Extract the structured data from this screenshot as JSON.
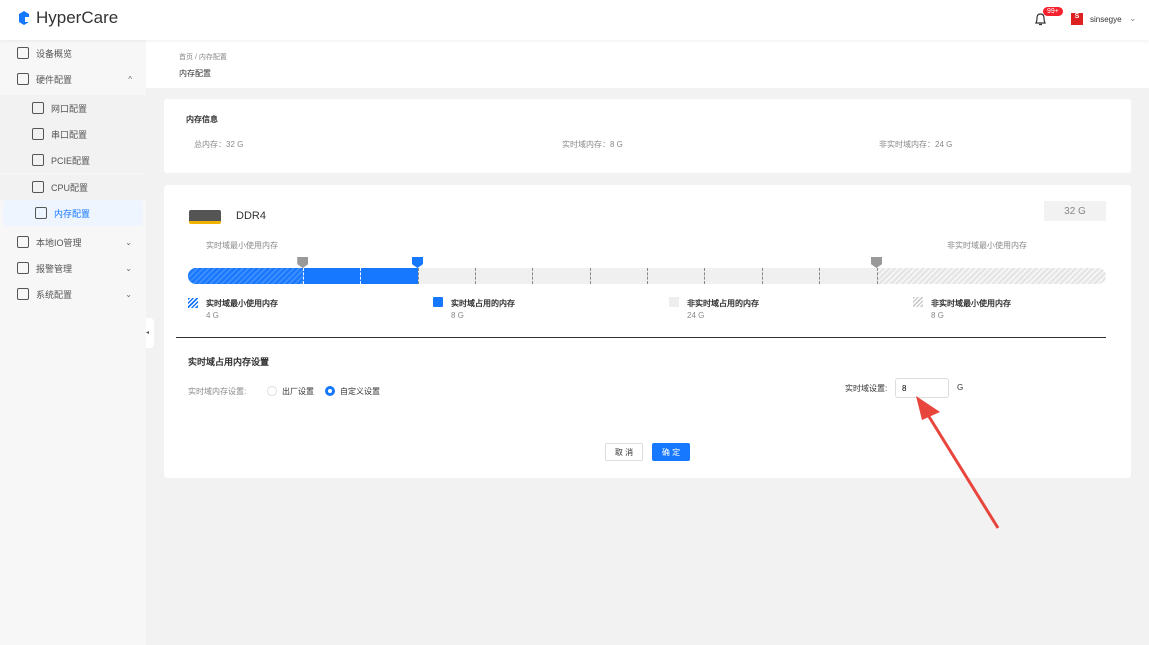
{
  "app": {
    "name": "HyperCare"
  },
  "header": {
    "badge": "99+",
    "username": "sinsegye"
  },
  "sidebar": {
    "items": [
      {
        "label": "设备概览"
      },
      {
        "label": "硬件配置"
      },
      {
        "label": "网口配置"
      },
      {
        "label": "串口配置"
      },
      {
        "label": "PCIE配置"
      },
      {
        "label": "CPU配置"
      },
      {
        "label": "内存配置"
      },
      {
        "label": "本地IO管理"
      },
      {
        "label": "报警管理"
      },
      {
        "label": "系统配置"
      }
    ]
  },
  "breadcrumb": {
    "home": "首页",
    "sep": "/",
    "current": "内存配置"
  },
  "page_title": "内存配置",
  "info": {
    "title": "内存信息",
    "total": "总内存：32 G",
    "rt": "实时域内存：8 G",
    "nrt": "非实时域内存：24 G"
  },
  "ddr": {
    "name": "DDR4",
    "size": "32 G",
    "label_left": "实时域最小使用内存",
    "label_right": "非实时域最小使用内存",
    "total_gb": 32,
    "rt_min_gb": 4,
    "rt_used_gb": 8,
    "nrt_min_gb": 8
  },
  "legend": [
    {
      "label": "实时域最小使用内存",
      "value": "4 G"
    },
    {
      "label": "实时域占用的内存",
      "value": "8 G"
    },
    {
      "label": "非实时域占用的内存",
      "value": "24 G"
    },
    {
      "label": "非实时域最小使用内存",
      "value": "8 G"
    }
  ],
  "settings": {
    "title": "实时域占用内存设置",
    "mode_label": "实时域内存设置:",
    "opt_factory": "出厂设置",
    "opt_custom": "自定义设置",
    "rt_label": "实时域设置:",
    "rt_value": "8",
    "unit": "G"
  },
  "buttons": {
    "cancel": "取 消",
    "ok": "确 定"
  },
  "colors": {
    "primary": "#1677ff",
    "arrow": "#e8453c"
  }
}
